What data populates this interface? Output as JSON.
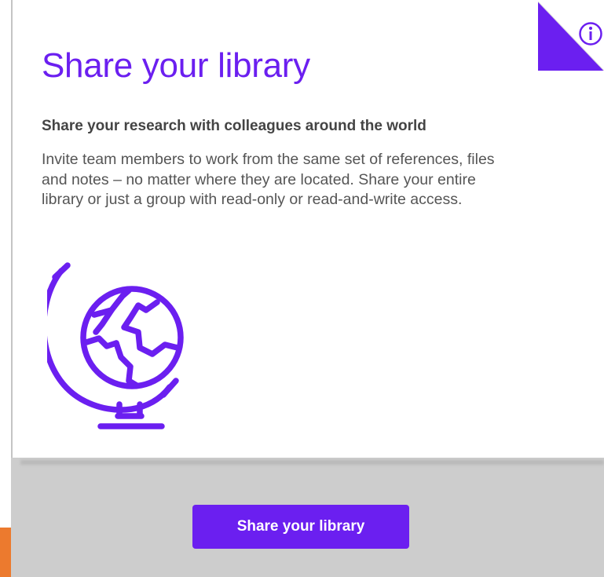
{
  "card": {
    "title": "Share your library",
    "subtitle": "Share your research with colleagues around the world",
    "description": "Invite team members to work from the same set of references, files and notes – no matter where they are located. Share your entire library or just a group with read-only or read-and-write access.",
    "illustration_icon": "globe-icon",
    "info_icon": "info-icon"
  },
  "cta": {
    "label": "Share your library"
  },
  "colors": {
    "accent": "#6b1ff0",
    "background": "#cdcdcd",
    "card": "#ffffff",
    "edge_accent": "#ec7a2e"
  }
}
